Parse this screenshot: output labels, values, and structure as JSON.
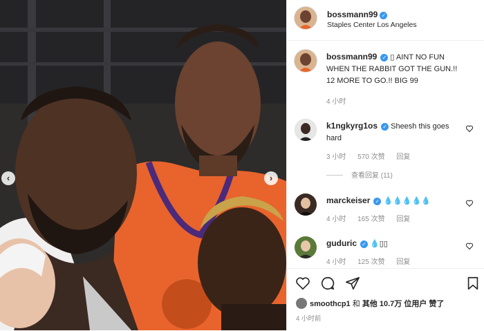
{
  "post": {
    "username": "bossmann99",
    "location": "Staples Center Los Angeles",
    "caption": "▯ AINT NO FUN WHEN THE RABBIT GOT THE GUN.!! 12 MORE TO GO.!! BIG 99",
    "caption_time": "4 小时",
    "posted_time": "4 小时前"
  },
  "comments": [
    {
      "username": "k1ngkyrg1os",
      "text": "Sheesh this goes hard",
      "time": "3 小时",
      "likes": "570 次赞",
      "reply": "回复"
    },
    {
      "username": "marckeiser",
      "text": "💧💧💧💧💧",
      "time": "4 小时",
      "likes": "165 次赞",
      "reply": "回复"
    },
    {
      "username": "guduric",
      "text": "💧▯▯",
      "time": "4 小时",
      "likes": "125 次赞",
      "reply": "回复"
    }
  ],
  "view_replies": "查看回复 (11)",
  "likes_line": {
    "user": "smoothcp1",
    "and": "和",
    "others": "其他",
    "count": "10.7万",
    "suffix": "位用户 赞了"
  },
  "icons": {
    "verified": "verified-badge-icon",
    "like": "heart-icon",
    "comment": "comment-bubble-icon",
    "share": "paper-plane-icon",
    "save": "bookmark-icon",
    "prev": "chevron-left-icon",
    "next": "chevron-right-icon"
  },
  "colors": {
    "verified": "#3897f0",
    "jersey": "#e8642c",
    "secondary_text": "#8e8e8e"
  }
}
